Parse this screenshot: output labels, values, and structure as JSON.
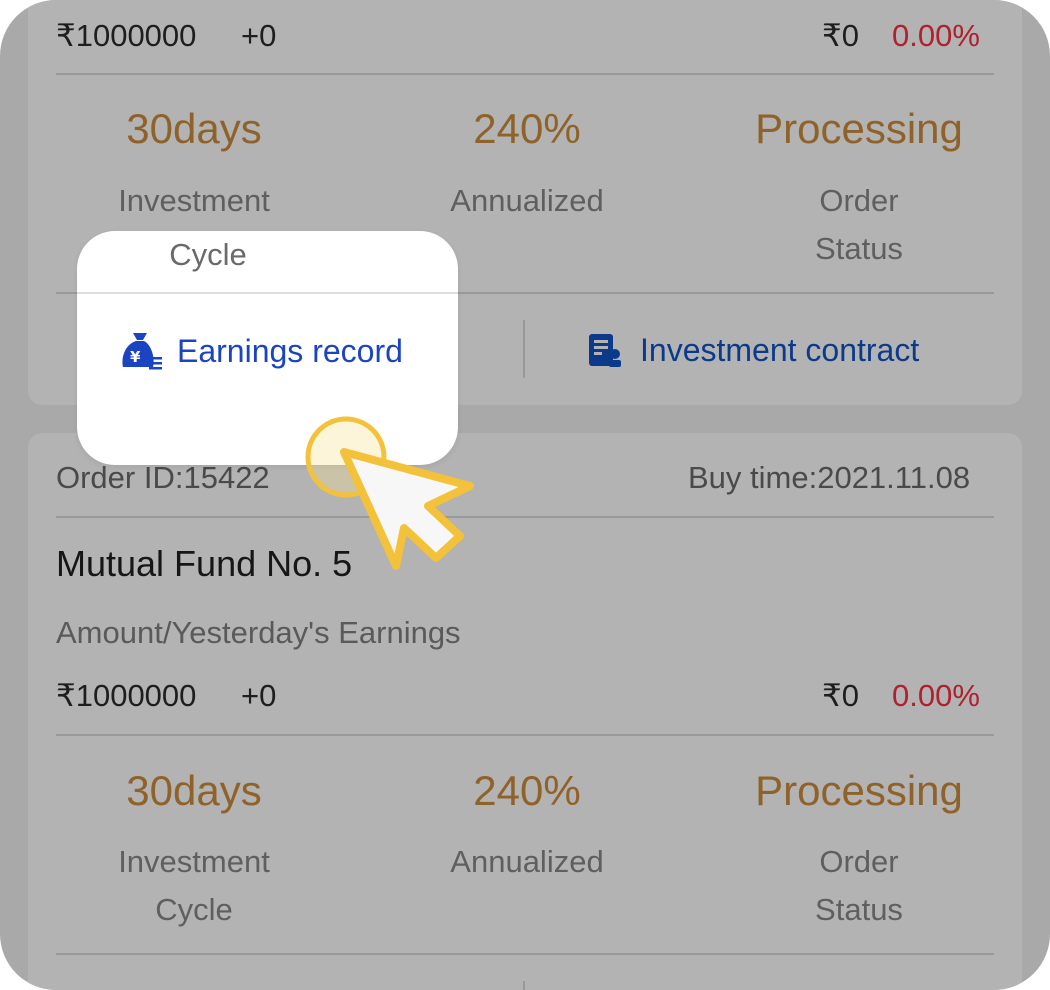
{
  "card1": {
    "amount": "₹1000000",
    "amount_change": "+0",
    "earnings": "₹0",
    "earnings_pct": "0.00%",
    "cycle_value": "30days",
    "cycle_label_1": "Investment",
    "cycle_label_2": "Cycle",
    "rate_value": "240%",
    "rate_label": "Annualized",
    "status_value": "Processing",
    "status_label_1": "Order",
    "status_label_2": "Status",
    "earnings_record_label": "Earnings record",
    "contract_label": "Investment contract"
  },
  "card2": {
    "order_id": "Order ID:15422",
    "buy_time": "Buy time:2021.11.08",
    "product_name": "Mutual Fund No. 5",
    "amount_caption": "Amount/Yesterday's Earnings",
    "amount": "₹1000000",
    "amount_change": "+0",
    "earnings": "₹0",
    "earnings_pct": "0.00%",
    "cycle_value": "30days",
    "cycle_label_1": "Investment",
    "cycle_label_2": "Cycle",
    "rate_value": "240%",
    "rate_label": "Annualized",
    "status_value": "Processing",
    "status_label_1": "Order",
    "status_label_2": "Status"
  },
  "colors": {
    "accent_gold": "#8f622a",
    "negative_red": "#b0202e",
    "link_blue": "#0c3a8a",
    "cursor_yellow": "#f3c23a"
  },
  "icons": {
    "earnings": "money-bag-yen-icon",
    "contract": "contract-document-icon",
    "pointer": "cursor-pointer-icon"
  }
}
